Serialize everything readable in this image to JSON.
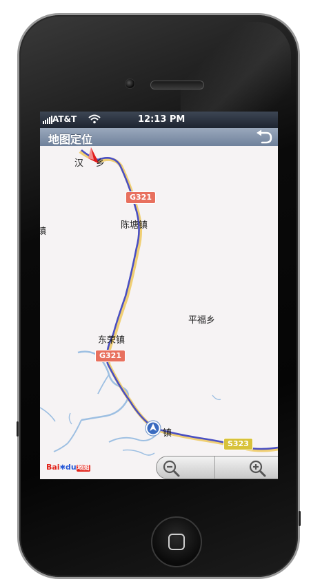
{
  "status_bar": {
    "carrier": "AT&T",
    "time": "12:13 PM"
  },
  "nav": {
    "title": "地图定位",
    "back_icon": "back-arrow-icon"
  },
  "map": {
    "places": {
      "han": "汉",
      "han_suffix": "乡",
      "chentang": "陈塘镇",
      "pingfu": "平福乡",
      "dongsheng": "东荣镇",
      "bottom_town": "镇",
      "left_edge": "镇"
    },
    "road_shields": {
      "g321_top": "G321",
      "g321_bottom": "G321",
      "s323": "S323"
    },
    "colors": {
      "route": "#4a4fc2",
      "road": "#f0cf74",
      "water": "#8fb5dc",
      "land": "#f6f3f4"
    },
    "icons": {
      "start_marker": "red-location-marker-icon",
      "current_location": "current-location-arrow-icon"
    }
  },
  "controls": {
    "zoom_out_icon": "zoom-out-icon",
    "zoom_in_icon": "zoom-in-icon"
  },
  "logo": {
    "bai": "Bai",
    "du": "du",
    "cn": "地图"
  }
}
